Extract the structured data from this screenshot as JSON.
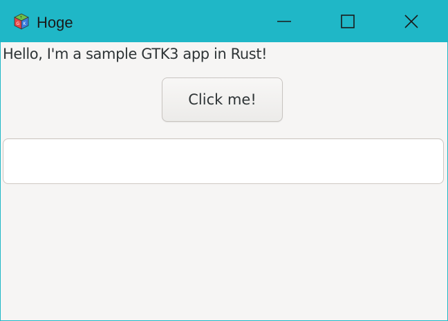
{
  "window": {
    "title": "Hoge",
    "icon": "gtk-cube-icon"
  },
  "titlebar_buttons": {
    "minimize_icon": "minimize-icon",
    "maximize_icon": "maximize-icon",
    "close_icon": "close-icon"
  },
  "content": {
    "label": "Hello, I'm a sample GTK3 app in Rust!",
    "button_label": "Click me!",
    "entry_value": "",
    "entry_placeholder": ""
  },
  "colors": {
    "accent": "#1fb7c7",
    "window_bg": "#f6f5f4",
    "text": "#2e3436"
  }
}
